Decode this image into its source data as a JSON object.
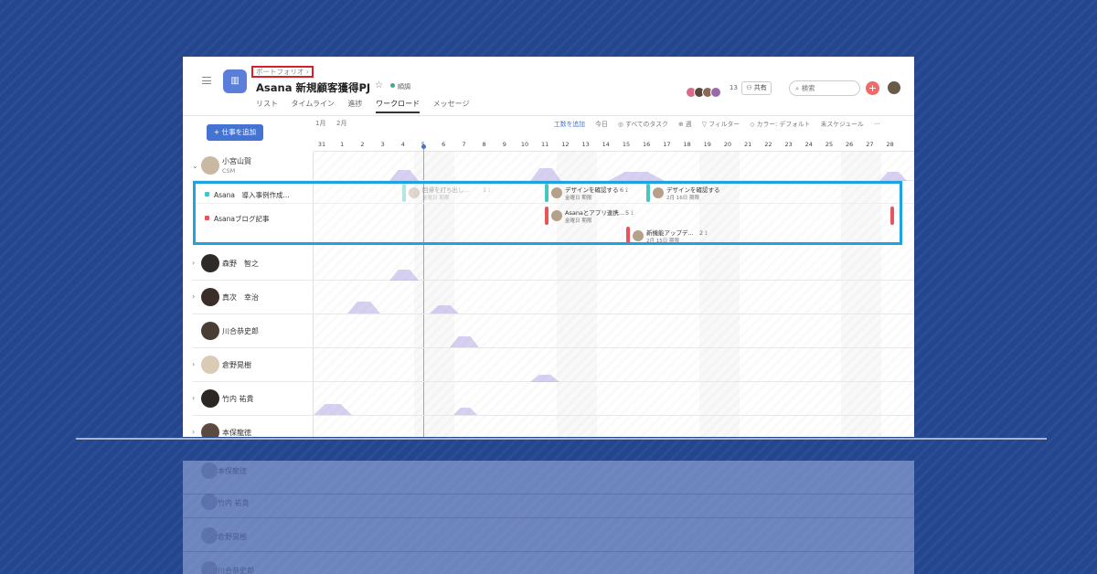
{
  "header": {
    "breadcrumb": "ポートフォリオ ›",
    "project_icon": "chart-icon",
    "title": "Asana 新規顧客獲得PJ",
    "status": "順調",
    "status_color": "#3cb180",
    "member_count": "13",
    "share_label": "共有",
    "search_placeholder": "検索",
    "add_icon": "+"
  },
  "tabs": [
    "リスト",
    "タイムライン",
    "進捗",
    "ワークロード",
    "メッセージ"
  ],
  "active_tab": "ワークロード",
  "toolbar": {
    "add_task": "+ 仕事を追加",
    "month_prev": "1月",
    "month_current": "2月",
    "add_effort": "工数を追加",
    "today": "今日",
    "all_tasks": "◎ すべてのタスク",
    "week": "⊕ 週",
    "filter": "▽ フィルター",
    "color": "◇ カラー: デフォルト",
    "unscheduled": "未スケジュール",
    "more": "···"
  },
  "days": [
    "31",
    "1",
    "2",
    "3",
    "4",
    "5",
    "6",
    "7",
    "8",
    "9",
    "10",
    "11",
    "12",
    "13",
    "14",
    "15",
    "16",
    "17",
    "18",
    "19",
    "20",
    "21",
    "22",
    "23",
    "24",
    "25",
    "26",
    "27",
    "28"
  ],
  "people": [
    {
      "name": "小宮山賀",
      "role": "CSM",
      "color": "#c9b8a4"
    },
    {
      "name": "森野　智之",
      "role": "",
      "color": "#2e2a28"
    },
    {
      "name": "真次　幸治",
      "role": "",
      "color": "#3a2d2a"
    },
    {
      "name": "川合恭史郎",
      "role": "",
      "color": "#4a3e34"
    },
    {
      "name": "倉野晃樹",
      "role": "",
      "color": "#d9cbb6"
    },
    {
      "name": "竹内 祐貴",
      "role": "",
      "color": "#2c2624"
    },
    {
      "name": "本保龍徳",
      "role": "",
      "color": "#5b4a40"
    }
  ],
  "projects": [
    {
      "label": "Asana　導入事例作成...",
      "color": "#45c6c0"
    },
    {
      "label": "Asanaブログ記事",
      "color": "#e8545a"
    }
  ],
  "tasks": [
    {
      "name": "回帰を打ち出し...",
      "date": "金曜日 期限",
      "count": "1 ⟟",
      "color": "#45c6c0",
      "faded": true
    },
    {
      "name": "デザインを確認する",
      "date": "金曜日 期限",
      "count": "6 ⟟",
      "color": "#45c6c0",
      "faded": false
    },
    {
      "name": "デザインを確認する",
      "date": "2月 16日 期限",
      "count": "",
      "color": "#45c6c0",
      "faded": false
    },
    {
      "name": "Asanaとアプリ連携...",
      "date": "金曜日 期限",
      "count": "5 ⟟",
      "color": "#e8545a",
      "faded": false
    },
    {
      "name": "新機能アップデ...",
      "date": "2月 15日 期限",
      "count": "2 ⟟",
      "color": "#e8545a",
      "faded": false
    }
  ],
  "reflection_names": [
    "本保龍徳",
    "竹内 祐貴",
    "倉野晃樹",
    "川合恭史郎"
  ]
}
